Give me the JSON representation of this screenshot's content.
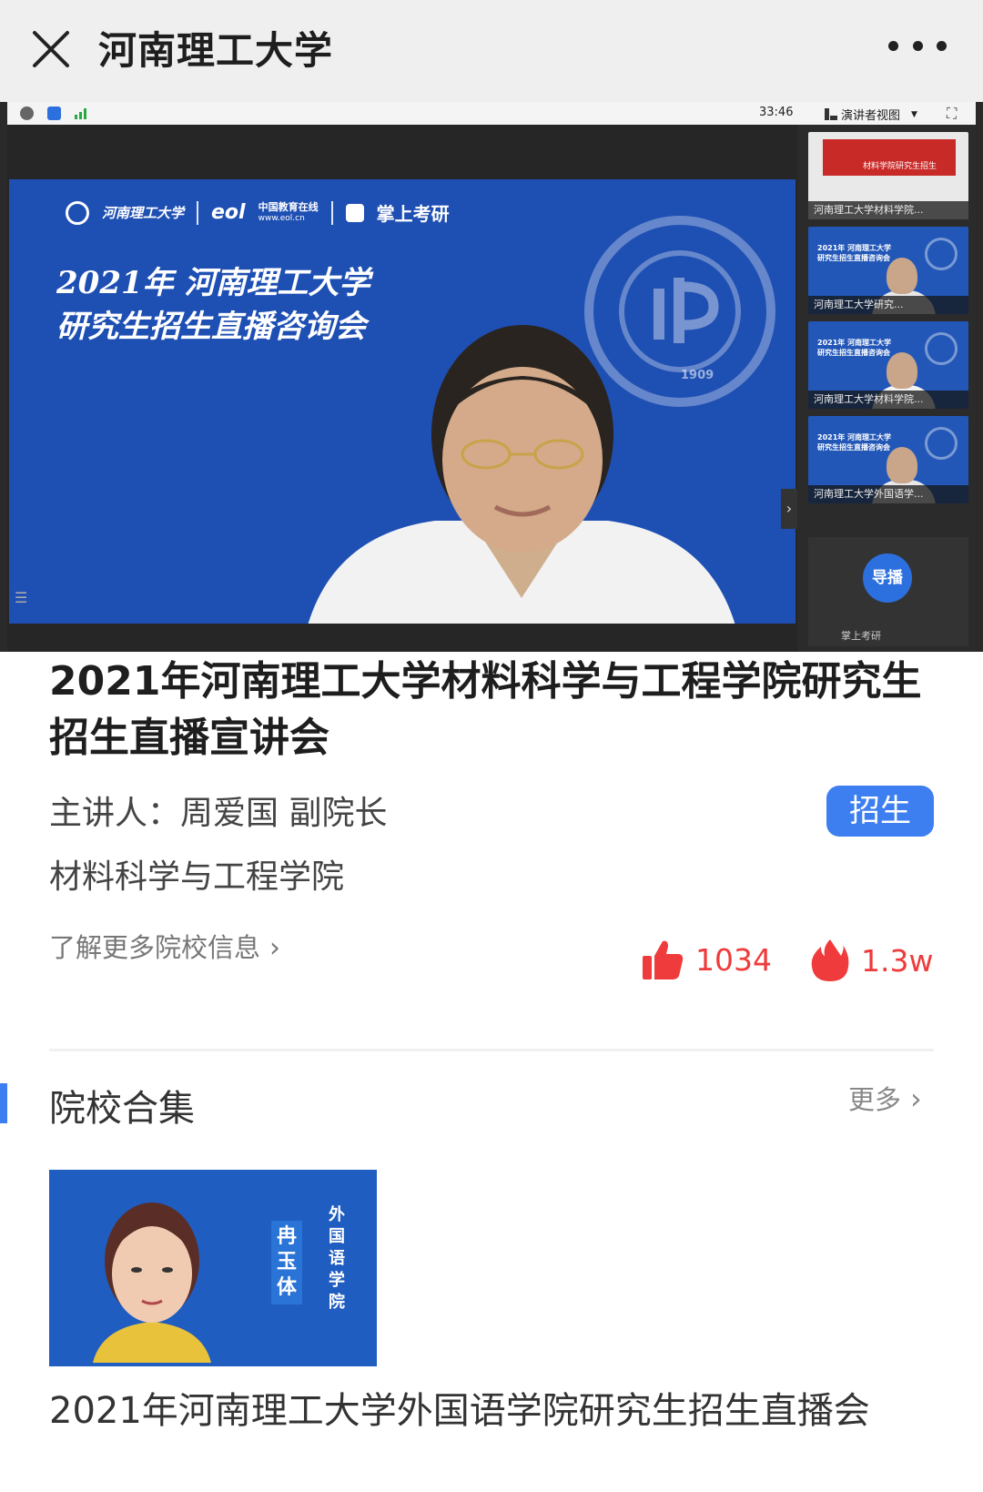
{
  "nav": {
    "title": "河南理工大学",
    "close_icon": "close-icon",
    "more_icon": "more-icon"
  },
  "player": {
    "elapsed": "33:46",
    "view_mode": "演讲者视图",
    "slide": {
      "logo_hpu": "河南理工大学",
      "logo_eol": "中国教育在线",
      "logo_eol_url": "www.eol.cn",
      "logo_kaoyan": "掌上考研",
      "title_line1": "2021年 河南理工大学",
      "title_line2": "研究生招生直播咨询会",
      "emblem_year": "1909"
    },
    "thumbnails": [
      {
        "label": "河南理工大学材料学院...",
        "title": "材料学院研究生招生"
      },
      {
        "label": "河南理工大学研究...",
        "title_line1": "2021年 河南理工大学",
        "title_line2": "研究生招生直播咨询会"
      },
      {
        "label": "河南理工大学材料学院...",
        "title_line1": "2021年 河南理工大学",
        "title_line2": "研究生招生直播咨询会"
      },
      {
        "label": "河南理工大学外国语学...",
        "title_line1": "2021年 河南理工大学",
        "title_line2": "研究生招生直播咨询会"
      }
    ],
    "director": {
      "button": "导播",
      "label": "掌上考研"
    }
  },
  "info": {
    "title": "2021年河南理工大学材料科学与工程学院研究生招生直播宣讲会",
    "speaker": "主讲人：周爱国 副院长",
    "tag": "招生",
    "department": "材料科学与工程学院",
    "learn_more": "了解更多院校信息",
    "likes": "1034",
    "heat": "1.3w",
    "accent_color": "#3d7ff0",
    "stat_color": "#ef3b3b"
  },
  "collection": {
    "title": "院校合集",
    "more": "更多",
    "items": [
      {
        "name": "冉玉体",
        "department": "外国语学院",
        "title": "2021年河南理工大学外国语学院研究生招生直播会"
      }
    ]
  }
}
